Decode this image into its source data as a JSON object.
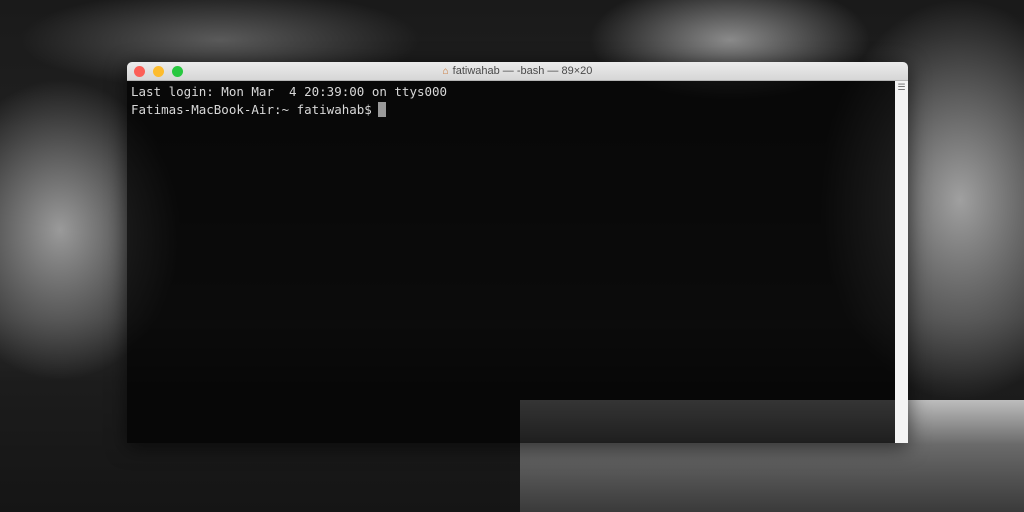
{
  "window": {
    "title": "fatiwahab — -bash — 89×20",
    "title_icon": "home-folder-icon"
  },
  "traffic_lights": {
    "close": "#fc5f57",
    "minimize": "#fdbc2e",
    "zoom": "#28c840"
  },
  "terminal": {
    "lines": [
      "Last login: Mon Mar  4 20:39:00 on ttys000"
    ],
    "prompt": "Fatimas-MacBook-Air:~ fatiwahab$"
  }
}
